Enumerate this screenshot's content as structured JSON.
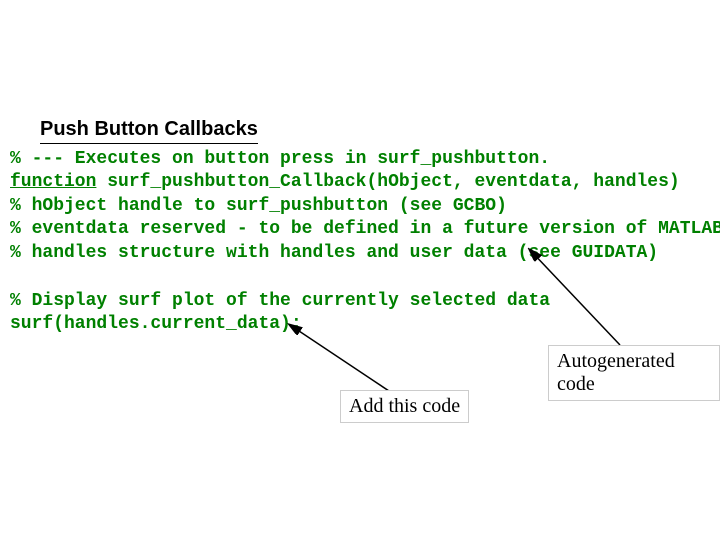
{
  "title": "Push Button Callbacks",
  "code1": {
    "l1": "% --- Executes on button press in surf_pushbutton.",
    "kw": "function",
    "l2": " surf_pushbutton_Callback(hObject, eventdata, handles)",
    "l3": "% hObject    handle to surf_pushbutton (see GCBO)",
    "l4": "% eventdata  reserved - to be defined in a future version of MATLAB",
    "l5": "% handles    structure with handles and user data (see GUIDATA)"
  },
  "code2": {
    "l1": "% Display surf plot of the currently selected data",
    "l2": "surf(handles.current_data);"
  },
  "labels": {
    "auto": "Autogenerated code",
    "add": "Add this code"
  }
}
